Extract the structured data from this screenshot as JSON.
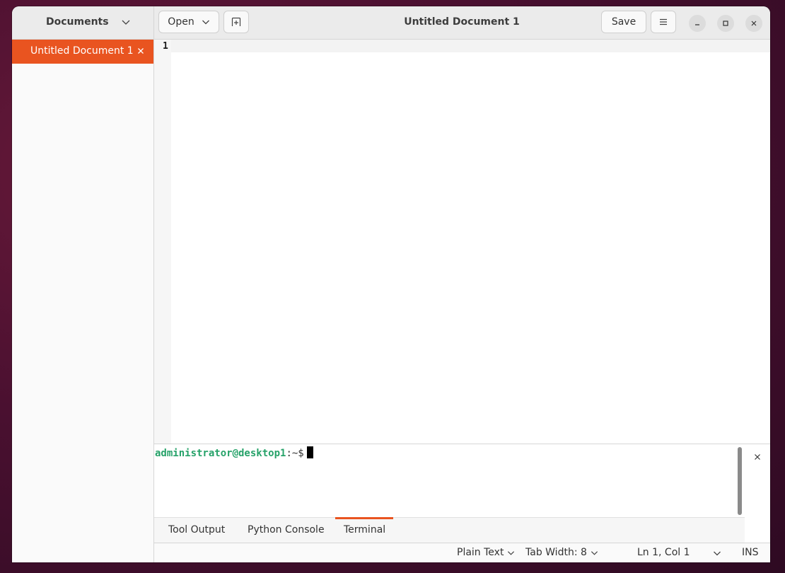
{
  "sidebar": {
    "header_title": "Documents",
    "documents": [
      {
        "label": "Untitled Document 1"
      }
    ]
  },
  "toolbar": {
    "open_label": "Open",
    "save_label": "Save"
  },
  "window": {
    "title": "Untitled Document 1"
  },
  "editor": {
    "line_numbers": [
      "1"
    ]
  },
  "terminal": {
    "prompt_user_host": "administrator@desktop1",
    "prompt_path": ":~$"
  },
  "bottom_panel": {
    "tabs": [
      "Tool Output",
      "Python Console",
      "Terminal"
    ],
    "active_tab": "Terminal"
  },
  "statusbar": {
    "language": "Plain Text",
    "tab_width": "Tab Width: 8",
    "cursor_position": "Ln 1, Col 1",
    "mode": "INS"
  },
  "colors": {
    "accent": "#e95420",
    "prompt_green": "#26a269"
  },
  "icons": [
    "chevron-down-icon",
    "new-tab-icon",
    "hamburger-menu-icon",
    "minimize-icon",
    "maximize-icon",
    "close-icon"
  ]
}
